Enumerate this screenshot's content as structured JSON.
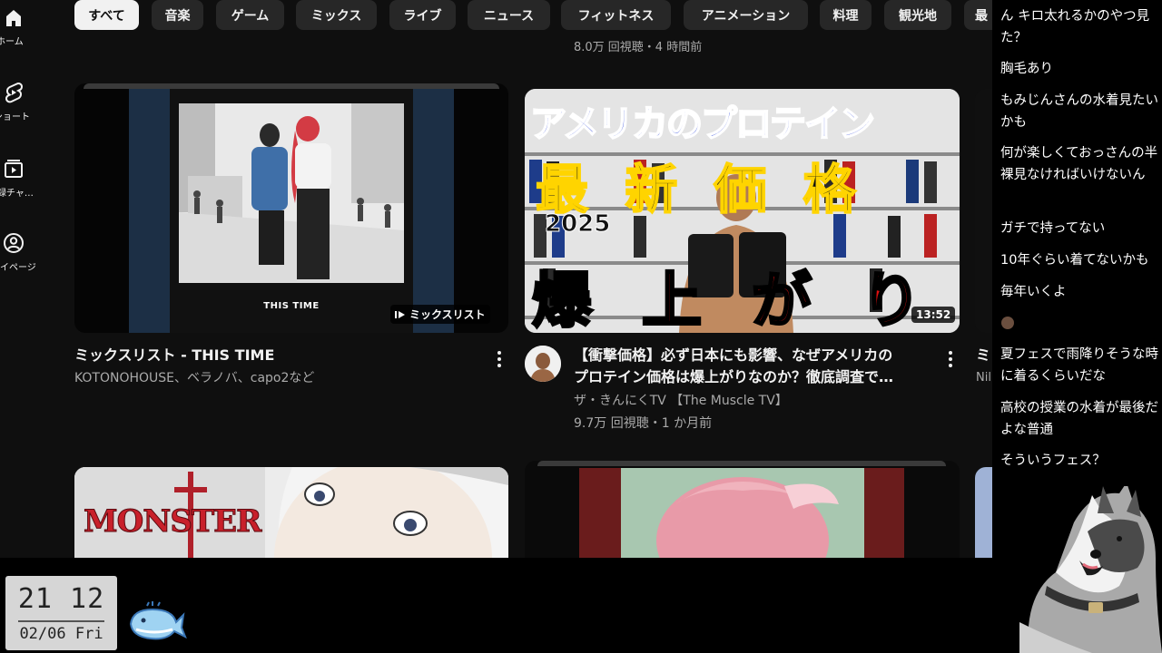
{
  "sidebar": {
    "items": [
      {
        "label": "ホーム",
        "icon": "home-icon"
      },
      {
        "label": "ショート",
        "icon": "shorts-icon"
      },
      {
        "label": "登録チャンネル",
        "icon": "subscriptions-icon"
      },
      {
        "label": "マイページ",
        "icon": "profile-icon"
      }
    ]
  },
  "chips": [
    "すべて",
    "音楽",
    "ゲーム",
    "ミックス",
    "ライブ",
    "ニュース",
    "フィットネス",
    "アニメーション",
    "料理",
    "観光地",
    "最"
  ],
  "top_meta": "8.0万 回視聴・4 時間前",
  "cards": [
    {
      "title": "ミックスリスト - THIS TIME",
      "subtitle": "KOTONOHOUSE、ベラノバ、capo2など",
      "badge": "ミックスリスト",
      "thumb_caption": "THIS TIME"
    },
    {
      "title_line1": "【衝撃価格】必ず日本にも影響、なぜアメリカの",
      "title_line2": "プロテイン価格は爆上がりなのか？徹底調査で…",
      "channel": "ザ・きんにくTV 【The Muscle TV】",
      "stats": "9.7万 回視聴・1 か月前",
      "duration": "13:52",
      "thumb_text_1": "アメリカのプロテイン",
      "thumb_text_2": "最 新 価 格",
      "thumb_year": "2025",
      "thumb_text_3": "爆 上 が り"
    },
    {
      "partial_title": "ミ",
      "partial_sub": "Nil"
    },
    {
      "thumb_logo": "MONSTER"
    }
  ],
  "chat": [
    "ん キロ太れるかのやつ見た？",
    "胸毛あり",
    "もみじんさんの水着見たいかも",
    "何が楽しくておっさんの半裸見なければいけないん",
    "ガチで持ってない",
    "10年ぐらい着てないかも",
    "毎年いくよ",
    "夏フェスで雨降りそうな時に着るくらいだな",
    "高校の授業の水着が最後だよな普通",
    "そういうフェス？"
  ],
  "clock": {
    "time": "21 12",
    "date": "02/06 Fri"
  },
  "colors": {
    "background": "#0f0f0f",
    "chip": "#272727",
    "chip_active": "#f1f1f1",
    "subtext": "#aaaaaa"
  }
}
